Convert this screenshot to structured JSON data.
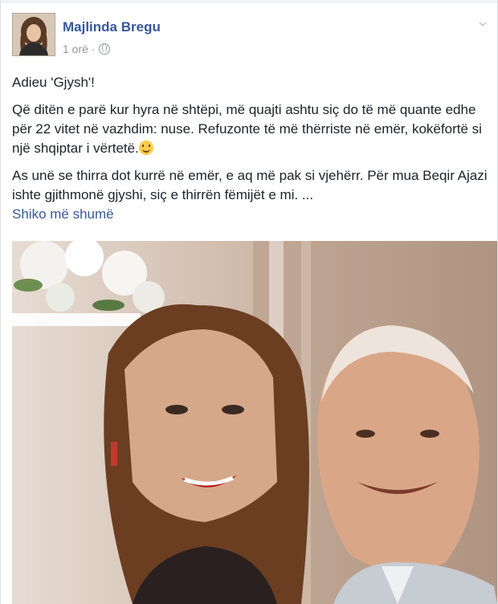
{
  "post": {
    "author": "Majlinda Bregu",
    "time": "1 orë",
    "separator": "·",
    "paragraphs": [
      "Adieu 'Gjysh'!",
      "Që ditën e parë kur hyra në shtëpi, më quajti ashtu siç do të më quante edhe për 22 vitet në vazhdim: nuse. Refuzonte të më thërriste në emër, kokëfortë si një shqiptar i vërtetë.",
      "As unë se thirra dot kurrë në emër, e aq më pak si vjehërr. Për mua Beqir Ajazi ishte gjithmonë gjyshi, siç e thirrën fëmijët e mi. ..."
    ],
    "see_more": "Shiko më shumë"
  },
  "icons": {
    "privacy": "globe-icon",
    "options": "chevron-down-icon",
    "emoji": "smile-emoji-icon"
  },
  "colors": {
    "link": "#365899",
    "text": "#1d2129",
    "meta": "#90949c"
  }
}
